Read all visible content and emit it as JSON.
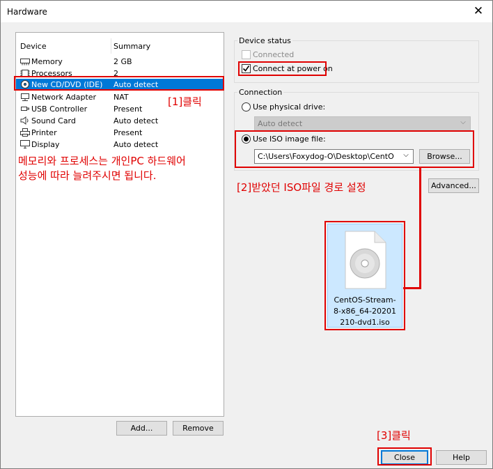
{
  "window": {
    "title": "Hardware",
    "close_glyph": "✕"
  },
  "device_list": {
    "headers": {
      "device": "Device",
      "summary": "Summary"
    },
    "items": [
      {
        "name": "Memory",
        "summary": "2 GB",
        "icon": "memory-icon"
      },
      {
        "name": "Processors",
        "summary": "2",
        "icon": "processor-icon"
      },
      {
        "name": "New CD/DVD (IDE)",
        "summary": "Auto detect",
        "icon": "cd-dvd-icon",
        "selected": true
      },
      {
        "name": "Network Adapter",
        "summary": "NAT",
        "icon": "network-adapter-icon"
      },
      {
        "name": "USB Controller",
        "summary": "Present",
        "icon": "usb-controller-icon"
      },
      {
        "name": "Sound Card",
        "summary": "Auto detect",
        "icon": "sound-card-icon"
      },
      {
        "name": "Printer",
        "summary": "Present",
        "icon": "printer-icon"
      },
      {
        "name": "Display",
        "summary": "Auto detect",
        "icon": "display-icon"
      }
    ],
    "add_label": "Add...",
    "remove_label": "Remove"
  },
  "device_status": {
    "title": "Device status",
    "connected_label": "Connected",
    "connected_checked": false,
    "connect_power_label": "Connect at power on",
    "connect_power_checked": true
  },
  "connection": {
    "title": "Connection",
    "physical_label": "Use physical drive:",
    "physical_value": "Auto detect",
    "iso_label": "Use ISO image file:",
    "iso_value": "C:\\Users\\Foxydog-O\\Desktop\\CentO",
    "browse_label": "Browse...",
    "advanced_label": "Advanced..."
  },
  "file_icon": {
    "name": "CentOS-Stream-8-x86_64-20201210-dvd1.iso",
    "lines": [
      "CentOS-Stream-",
      "8-x86_64-20201",
      "210-dvd1.iso"
    ]
  },
  "annotations": {
    "step1": "[1]클릭",
    "note_line1": "메모리와 프로세스는 개인PC 하드웨어",
    "note_line2": "성능에 따라 늘려주시면 됩니다.",
    "step2": "[2]받았던 ISO파일 경로 설정",
    "step3": "[3]클릭"
  },
  "footer": {
    "close_label": "Close",
    "help_label": "Help"
  },
  "colors": {
    "accent": "#0078d7",
    "annotation": "#e00000",
    "file_highlight": "#cce8ff"
  }
}
